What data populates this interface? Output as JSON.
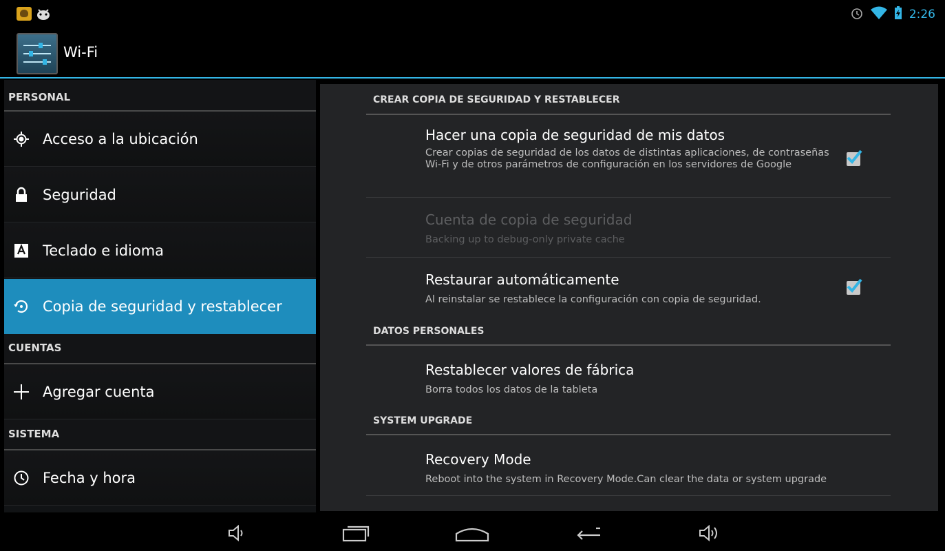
{
  "status_bar": {
    "time": "2:26",
    "left_icons": [
      "app-notification-icon",
      "android-debug-icon"
    ],
    "right_icons": [
      "alarm-icon",
      "wifi-icon",
      "battery-charging-icon"
    ]
  },
  "action_bar": {
    "title": "Wi-Fi",
    "icon": "settings-sliders-icon"
  },
  "sidebar": {
    "sections": [
      {
        "header": "PERSONAL",
        "items": [
          {
            "label": "Acceso a la ubicación",
            "icon": "location-icon"
          },
          {
            "label": "Seguridad",
            "icon": "lock-icon"
          },
          {
            "label": "Teclado e idioma",
            "icon": "keyboard-language-icon"
          },
          {
            "label": "Copia de seguridad y restablecer",
            "icon": "backup-restore-icon",
            "selected": true
          }
        ]
      },
      {
        "header": "CUENTAS",
        "items": [
          {
            "label": "Agregar cuenta",
            "icon": "plus-icon"
          }
        ]
      },
      {
        "header": "SISTEMA",
        "items": [
          {
            "label": "Fecha y hora",
            "icon": "clock-icon"
          }
        ]
      }
    ]
  },
  "main": {
    "sections": [
      {
        "header": "CREAR COPIA DE SEGURIDAD Y RESTABLECER",
        "items": [
          {
            "title": "Hacer una copia de seguridad de mis datos",
            "summary": "Crear copias de seguridad de los datos de distintas aplicaciones, de contraseñas Wi-Fi y de otros parámetros de configuración en los servidores de Google",
            "checkbox": true,
            "checked": true,
            "enabled": true
          },
          {
            "title": "Cuenta de copia de seguridad",
            "summary": "Backing up to debug-only private cache",
            "checkbox": false,
            "enabled": false
          },
          {
            "title": "Restaurar automáticamente",
            "summary": "Al reinstalar se restablece la configuración con copia de seguridad.",
            "checkbox": true,
            "checked": true,
            "enabled": true
          }
        ]
      },
      {
        "header": "DATOS PERSONALES",
        "items": [
          {
            "title": "Restablecer valores de fábrica",
            "summary": "Borra todos los datos de la tableta",
            "checkbox": false,
            "enabled": true
          }
        ]
      },
      {
        "header": "SYSTEM UPGRADE",
        "items": [
          {
            "title": "Recovery Mode",
            "summary": "Reboot into the system in Recovery Mode.Can clear the data or system upgrade",
            "checkbox": false,
            "enabled": true
          }
        ]
      }
    ]
  },
  "nav_bar": {
    "buttons": [
      "volume-down-icon",
      "recent-apps-icon",
      "home-icon",
      "back-icon",
      "volume-up-icon"
    ]
  },
  "colors": {
    "accent": "#33b5e5",
    "selected_item": "#1e8dbd",
    "pane_bg": "#232426",
    "checkbox_check": "#33b5e5"
  }
}
